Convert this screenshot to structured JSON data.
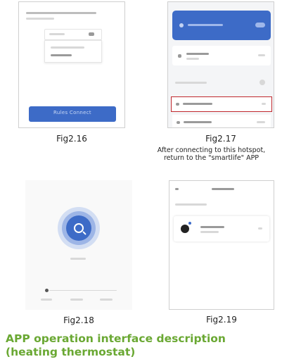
{
  "figures": {
    "fig216": {
      "caption": "Fig2.16",
      "button_label": "Rules Connect"
    },
    "fig217": {
      "caption": "Fig2.17",
      "note_line1": "After connecting to this hotspot,",
      "note_line2": "return to the \"smartlife\" APP"
    },
    "fig218": {
      "caption": "Fig2.18"
    },
    "fig219": {
      "caption": "Fig2.19"
    }
  },
  "section": {
    "title_line1": "APP operation interface description",
    "title_line2": "(heating thermostat)"
  },
  "colors": {
    "heading": "#6aa833",
    "highlight_border": "#c0272d",
    "blue_primary": "#3d6bc7",
    "blue_secondary": "#2f56ad"
  }
}
